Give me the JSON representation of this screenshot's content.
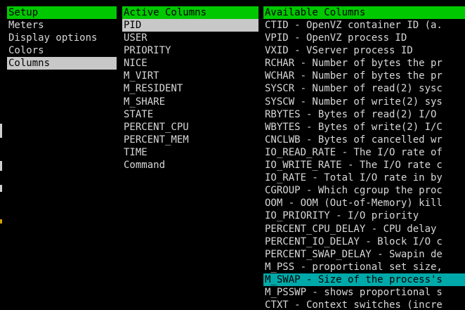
{
  "colors": {
    "header_bg": "#00c800",
    "selected_gray": "#c8c8c8",
    "selected_cyan": "#00a9a9",
    "background": "#000000",
    "text": "#d8d8d8"
  },
  "setup": {
    "header": "Setup",
    "items": [
      "Meters",
      "Display options",
      "Colors",
      "Columns"
    ],
    "selected_index": 3
  },
  "active_columns": {
    "header": "Active Columns",
    "items": [
      "PID",
      "USER",
      "PRIORITY",
      "NICE",
      "M_VIRT",
      "M_RESIDENT",
      "M_SHARE",
      "STATE",
      "PERCENT_CPU",
      "PERCENT_MEM",
      "TIME",
      "Command"
    ],
    "selected_index": 0
  },
  "available_columns": {
    "header": "Available Columns",
    "items": [
      "CTID - OpenVZ container ID (a.",
      "VPID - OpenVZ process ID",
      "VXID - VServer process ID",
      "RCHAR - Number of bytes the pr",
      "WCHAR - Number of bytes the pr",
      "SYSCR - Number of read(2) sysc",
      "SYSCW - Number of write(2) sys",
      "RBYTES - Bytes of read(2) I/O",
      "WBYTES - Bytes of write(2) I/C",
      "CNCLWB - Bytes of cancelled wr",
      "IO_READ_RATE - The I/O rate of",
      "IO_WRITE_RATE - The I/O rate c",
      "IO_RATE - Total I/O rate in by",
      "CGROUP - Which cgroup the proc",
      "OOM - OOM (Out-of-Memory) kill",
      "IO_PRIORITY - I/O priority",
      "PERCENT_CPU_DELAY - CPU delay",
      "PERCENT_IO_DELAY - Block I/O c",
      "PERCENT_SWAP_DELAY - Swapin de",
      "M_PSS - proportional set size,",
      "M_SWAP - Size of the process's",
      "M_PSSWP - shows proportional s",
      "CTXT - Context switches (incre"
    ],
    "selected_index": 20
  }
}
